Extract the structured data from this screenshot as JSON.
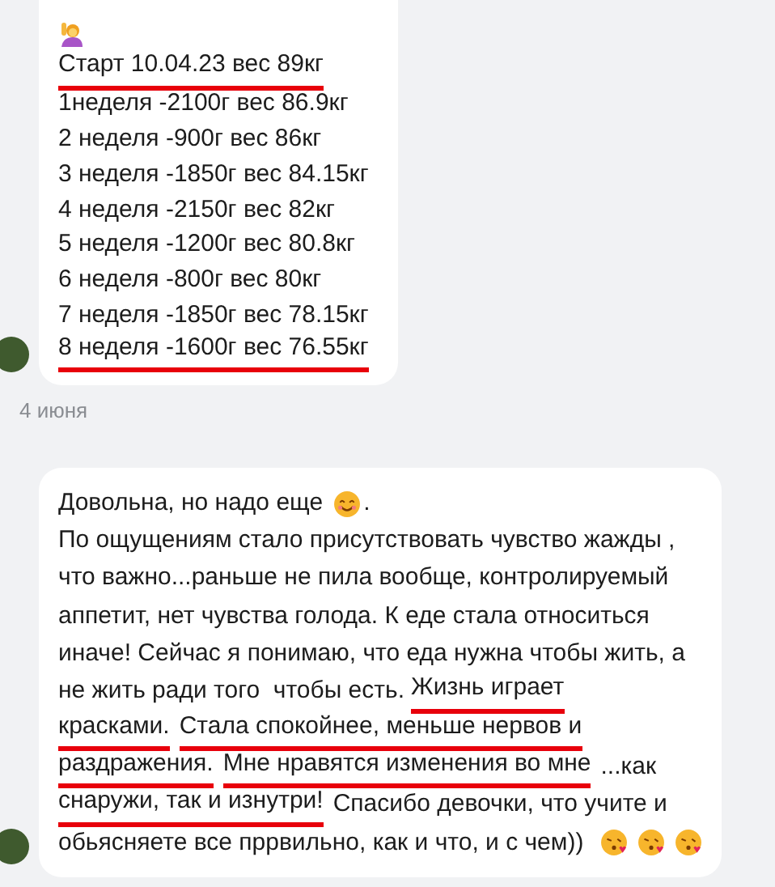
{
  "messages": [
    {
      "lines": [
        [
          {
            "kind": "raised_hand"
          }
        ],
        [
          {
            "text": "Старт 10.04.23 вес 89кг",
            "underlined": true
          }
        ],
        [
          {
            "text": "1неделя -2100г вес 86.9кг",
            "underlined": false
          }
        ],
        [
          {
            "text": "2 неделя -900г вес 86кг",
            "underlined": false
          }
        ],
        [
          {
            "text": "3 неделя -1850г вес 84.15кг",
            "underlined": false
          }
        ],
        [
          {
            "text": "4 неделя -2150г вес 82кг",
            "underlined": false
          }
        ],
        [
          {
            "text": "5 неделя -1200г вес 80.8кг",
            "underlined": false
          }
        ],
        [
          {
            "text": "6 неделя -800г вес 80кг",
            "underlined": false
          }
        ],
        [
          {
            "text": "7 неделя -1850г вес 78.15кг",
            "underlined": false
          }
        ],
        [
          {
            "text": "8 неделя -1600г вес 76.55кг",
            "underlined": true
          }
        ]
      ]
    },
    {
      "date": "4 июня"
    },
    {
      "lines": [
        [
          {
            "text": "Довольна, но надо еще",
            "underlined": false
          },
          {
            "kind": "smile"
          },
          {
            "text": ".",
            "underlined": false
          }
        ],
        [
          {
            "text": "По ощущениям стало присутствовать чувство жажды ,",
            "underlined": false
          }
        ],
        [
          {
            "text": "что важно...раньше не пила вообще, контролируемый",
            "underlined": false
          }
        ],
        [
          {
            "text": "аппетит, нет чувства голода. К еде стала относиться",
            "underlined": false
          }
        ],
        [
          {
            "text": "иначе! Сейчас я понимаю, что еда нужна чтобы жить, а",
            "underlined": false
          }
        ],
        [
          {
            "text": "не жить ради того  чтобы есть.",
            "underlined": false
          },
          {
            "text": "Жизнь играет",
            "underlined": true
          }
        ],
        [
          {
            "text": "красками.",
            "underlined": true
          },
          {
            "text": "Стала спокойнее, меньше нервов и",
            "underlined": true
          }
        ],
        [
          {
            "text": "раздражения.",
            "underlined": true
          },
          {
            "text": "Мне нравятся изменения во мне",
            "underlined": true
          },
          {
            "text": "...как",
            "underlined": false
          }
        ],
        [
          {
            "text": "снаружи, так и изнутри!",
            "underlined": true
          },
          {
            "text": "Спасибо девочки, что учите и",
            "underlined": false
          }
        ],
        [
          {
            "text": "обьясняете все пррвильно, как и что, и с чем))",
            "underlined": false
          },
          {
            "kind": "kiss"
          },
          {
            "kind": "kiss"
          },
          {
            "kind": "kiss"
          }
        ]
      ]
    }
  ]
}
